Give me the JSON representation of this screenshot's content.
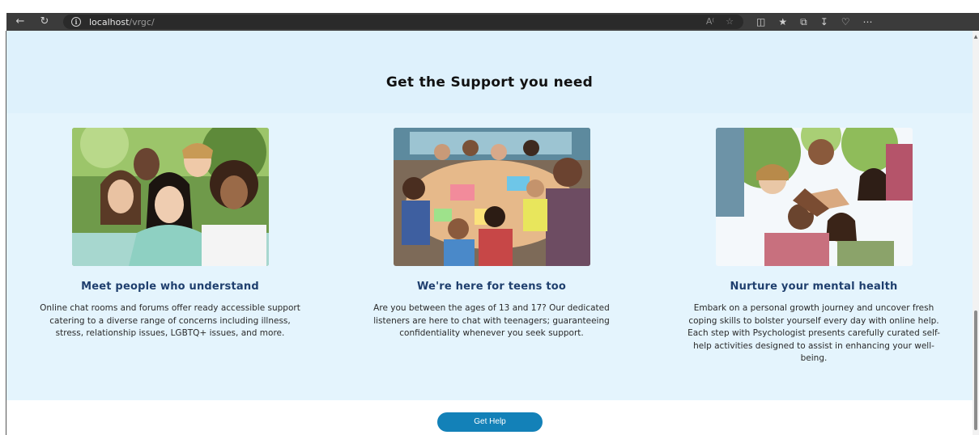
{
  "browser": {
    "url_host": "localhost",
    "url_path": "/vrgc/"
  },
  "section": {
    "title": "Get the Support you need"
  },
  "cards": [
    {
      "title": "Meet people who understand",
      "text": "Online chat rooms and forums offer ready accessible support catering to a diverse range of concerns including illness, stress, relationship issues, LGBTQ+ issues, and more."
    },
    {
      "title": "We're here for teens too",
      "text": "Are you between the ages of 13 and 17? Our dedicated listeners are here to chat with teenagers; guaranteeing confidentiality whenever you seek support."
    },
    {
      "title": "Nurture your mental health",
      "text": "Embark on a personal growth journey and uncover fresh coping skills to bolster yourself every day with online help. Each step with Psychologist presents carefully curated self-help activities designed to assist in enhancing your well-being."
    }
  ],
  "cta": {
    "label": "Get Help"
  },
  "colors": {
    "accent": "#1381b8",
    "band": "#e4f4fd",
    "card_title": "#1f3f6e"
  }
}
